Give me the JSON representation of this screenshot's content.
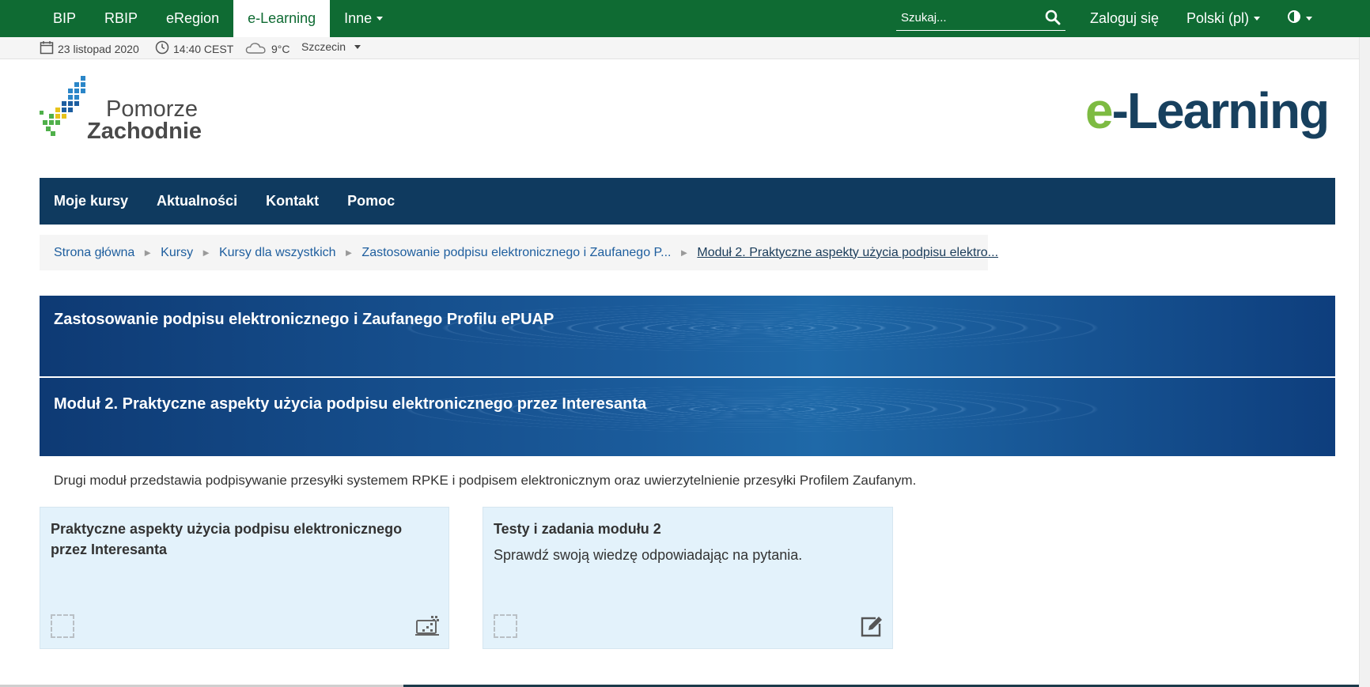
{
  "topnav": {
    "items": [
      "BIP",
      "RBIP",
      "eRegion",
      "e-Learning",
      "Inne"
    ],
    "active_index": 3,
    "search_placeholder": "Szukaj...",
    "login": "Zaloguj się",
    "language": "Polski (pl)"
  },
  "infobar": {
    "date": "23 listopad 2020",
    "time": "14:40 CEST",
    "temperature": "9°C",
    "city": "Szczecin"
  },
  "logo": {
    "line1": "Pomorze",
    "line2": "Zachodnie"
  },
  "elearning_logo": {
    "e_part": "e",
    "rest": "-Learning"
  },
  "mainnav": {
    "items": [
      "Moje kursy",
      "Aktualności",
      "Kontakt",
      "Pomoc"
    ]
  },
  "breadcrumb": {
    "items": [
      "Strona główna",
      "Kursy",
      "Kursy dla wszystkich",
      "Zastosowanie podpisu elektronicznego i Zaufanego P...",
      "Moduł 2. Praktyczne aspekty użycia podpisu elektro..."
    ],
    "separator": "►"
  },
  "course": {
    "title": "Zastosowanie podpisu elektronicznego i Zaufanego Profilu ePUAP",
    "module_title": "Moduł 2. Praktyczne aspekty użycia podpisu elektronicznego przez Interesanta",
    "description": "Drugi moduł przedstawia podpisywanie przesyłki systemem RPKE i podpisem elektronicznym oraz uwierzytelnienie przesyłki Profilem Zaufanym."
  },
  "cards": [
    {
      "title": "Praktyczne aspekty użycia podpisu elektronicznego przez Interesanta",
      "description": "",
      "icon": "scorm-package-icon"
    },
    {
      "title": "Testy i zadania modułu 2",
      "description": "Sprawdź swoją wiedzę odpowiadając na pytania.",
      "icon": "quiz-edit-icon"
    }
  ],
  "colors": {
    "topbar": "#0f6b33",
    "mainnav": "#0f3a5f",
    "card_bg": "#e3f2fb",
    "link": "#1e5e9e",
    "logo_green": "#7dbb42",
    "logo_navy": "#17405e"
  }
}
